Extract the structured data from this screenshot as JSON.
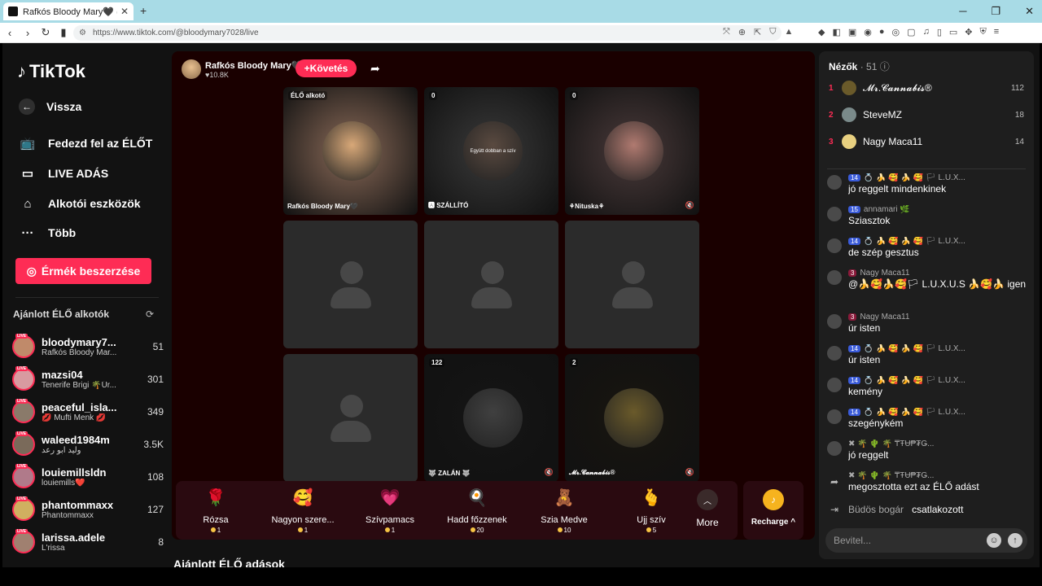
{
  "browser": {
    "tab_title": "Rafkós Bloody Mary🖤 (@blo",
    "url": "https://www.tiktok.com/@bloodymary7028/live"
  },
  "sidebar": {
    "logo": "TikTok",
    "nav": [
      {
        "label": "Vissza",
        "icon": "back-arrow-icon"
      },
      {
        "label": "Fedezd fel az ÉLŐT",
        "icon": "tv-icon"
      },
      {
        "label": "LIVE ADÁS",
        "icon": "camera-icon"
      },
      {
        "label": "Alkotói eszközök",
        "icon": "creator-tools-icon"
      },
      {
        "label": "Több",
        "icon": "more-dots-icon"
      }
    ],
    "coins_button": "Érmék beszerzése",
    "recommended_heading": "Ajánlott ÉLŐ alkotók",
    "creators": [
      {
        "name": "bloodymary7...",
        "sub": "Rafkós Bloody Mar...",
        "count": "51",
        "color": "#c08a6a"
      },
      {
        "name": "mazsi04",
        "sub": "Tenerife Brigi 🌴Úr...",
        "count": "301",
        "color": "#d89aa0"
      },
      {
        "name": "peaceful_isla...",
        "sub": "💋 Mufti Menk 💋",
        "count": "349",
        "color": "#8a7a6a"
      },
      {
        "name": "waleed1984m",
        "sub": "وليد ابو رعد",
        "count": "3.5K",
        "color": "#7a6a5a"
      },
      {
        "name": "louiemillsldn",
        "sub": "louiemills❤️",
        "count": "108",
        "color": "#b07a8a"
      },
      {
        "name": "phantommaxx",
        "sub": "Phantommaxx",
        "count": "127",
        "color": "#d0b060"
      },
      {
        "name": "larissa.adele",
        "sub": "L'rissa",
        "count": "8",
        "color": "#a08070"
      }
    ],
    "live_badge": "LIVE"
  },
  "stream": {
    "host_name": "Rafkós Bloody Mary🖤",
    "host_likes": "♥10.8K",
    "follow_label": "+Követés",
    "tiles": [
      {
        "tag": "ÉLŐ alkotó",
        "label": "Rafkós Bloody Mary🖤",
        "kind": "video",
        "bg": "#8a6a58",
        "circle": "#d8a878"
      },
      {
        "tag": "0",
        "label": "🅰 SZÁLLÍTÓ",
        "kind": "video",
        "bg": "#3a3a3a",
        "circle": "#5a4a40"
      },
      {
        "tag": "0",
        "label": "⚘Nituska⚘",
        "kind": "video",
        "bg": "#4a3a3a",
        "circle": "#b07a70"
      },
      {
        "tag": "",
        "label": "",
        "kind": "empty"
      },
      {
        "tag": "",
        "label": "",
        "kind": "empty"
      },
      {
        "tag": "",
        "label": "",
        "kind": "empty"
      },
      {
        "tag": "",
        "label": "",
        "kind": "empty"
      },
      {
        "tag": "122",
        "label": "🐺 ZALÁN 🐺",
        "kind": "video",
        "bg": "#151515",
        "circle": "#404040"
      },
      {
        "tag": "2",
        "label": "𝓜𝓻.𝓒𝓪𝓷𝓷𝓪𝓫𝓲𝓼®",
        "kind": "video",
        "bg": "#181510",
        "circle": "#6a5a2a"
      }
    ],
    "circle_caption": "Együtt dobban a szív",
    "gifts": [
      {
        "name": "Rózsa",
        "price": "1",
        "icon": "🌹"
      },
      {
        "name": "Nagyon szere...",
        "price": "1",
        "icon": "🥰"
      },
      {
        "name": "Szívpamacs",
        "price": "1",
        "icon": "💗"
      },
      {
        "name": "Hadd főzzenek",
        "price": "20",
        "icon": "🍳"
      },
      {
        "name": "Szia Medve",
        "price": "10",
        "icon": "🧸"
      },
      {
        "name": "Ujj szív",
        "price": "5",
        "icon": "🫰"
      }
    ],
    "more_label": "More",
    "recharge_label": "Recharge ^",
    "below_title": "Ajánlott ÉLŐ adások"
  },
  "chat": {
    "viewers_label": "Nézők",
    "viewers_count": "· 51",
    "top_viewers": [
      {
        "rank": "1",
        "name": "𝓜𝓻.𝓒𝓪𝓷𝓷𝓪𝓫𝓲𝓼®",
        "score": "112",
        "color": "#6a5a2a"
      },
      {
        "rank": "2",
        "name": "SteveMZ",
        "score": "18",
        "color": "#7a8a8a"
      },
      {
        "rank": "3",
        "name": "Nagy Maca11",
        "score": "14",
        "color": "#e8d080"
      }
    ],
    "messages": [
      {
        "badge": "14",
        "user": "💍 🍌 🥰 🍌 🥰 🏳 L.U.X...",
        "text": "jó reggelt mindenkinek"
      },
      {
        "badge": "15",
        "user": "annamari 🌿",
        "text": "Sziasztok"
      },
      {
        "badge": "14",
        "user": "💍 🍌 🥰 🍌 🥰 🏳 L.U.X...",
        "text": "de szép gesztus"
      },
      {
        "badge": "3",
        "user": "Nagy Maca11",
        "text": "@🍌🥰🍌🥰🏳 L.U.X.U.S 🍌🥰🍌 igen 🍀"
      },
      {
        "badge": "3",
        "user": "Nagy Maca11",
        "text": "úr isten"
      },
      {
        "badge": "14",
        "user": "💍 🍌 🥰 🍌 🥰 🏳 L.U.X...",
        "text": "úr isten"
      },
      {
        "badge": "14",
        "user": "💍 🍌 🥰 🍌 🥰 🏳 L.U.X...",
        "text": "kemény"
      },
      {
        "badge": "14",
        "user": "💍 🍌 🥰 🍌 🥰 🏳 L.U.X...",
        "text": "szegénykém"
      },
      {
        "badge": "",
        "user": "✖ 🌴 🌵 🌴 ₸ŦɄ₱₮Ǥ...",
        "text": "jó reggelt"
      }
    ],
    "share_user": "✖ 🌴 🌵 🌴 ₸ŦɄ₱₮Ǥ...",
    "share_text": "megosztotta ezt az ÉLŐ adást",
    "join_user": "Büdös bogár",
    "join_text": "csatlakozott",
    "input_placeholder": "Bevitel..."
  }
}
